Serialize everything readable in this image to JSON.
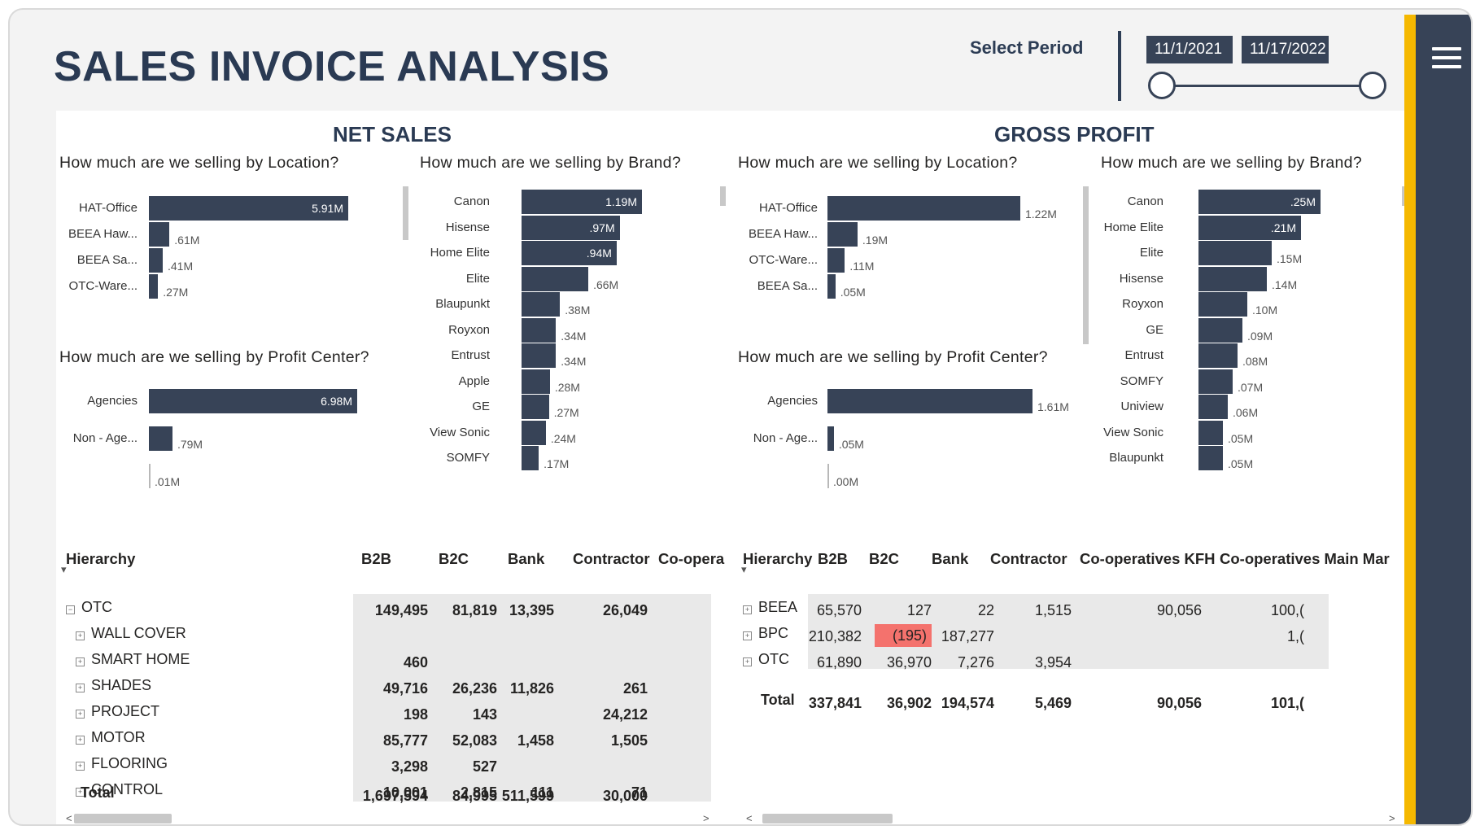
{
  "title": "SALES INVOICE ANALYSIS",
  "period": {
    "label": "Select Period",
    "start": "11/1/2021",
    "end": "11/17/2022"
  },
  "net_sales": {
    "title": "NET SALES",
    "by_location": {
      "question": "How much are we selling by Location?",
      "chart_data": {
        "type": "bar",
        "orientation": "horizontal",
        "categories": [
          "HAT-Office",
          "BEEA Haw...",
          "BEEA Sa...",
          "OTC-Ware..."
        ],
        "values": [
          5.91,
          0.61,
          0.41,
          0.27
        ],
        "labels": [
          "5.91M",
          ".61M",
          ".41M",
          ".27M"
        ]
      }
    },
    "by_brand": {
      "question": "How much are we selling by Brand?",
      "chart_data": {
        "type": "bar",
        "orientation": "horizontal",
        "categories": [
          "Canon",
          "Hisense",
          "Home Elite",
          "Elite",
          "Blaupunkt",
          "Royxon",
          "Entrust",
          "Apple",
          "GE",
          "View Sonic",
          "SOMFY"
        ],
        "values": [
          1.19,
          0.97,
          0.94,
          0.66,
          0.38,
          0.34,
          0.34,
          0.28,
          0.27,
          0.24,
          0.17
        ],
        "labels": [
          "1.19M",
          ".97M",
          ".94M",
          ".66M",
          ".38M",
          ".34M",
          ".34M",
          ".28M",
          ".27M",
          ".24M",
          ".17M"
        ]
      }
    },
    "by_profit_center": {
      "question": "How much are we selling by Profit Center?",
      "chart_data": {
        "type": "bar",
        "orientation": "horizontal",
        "categories": [
          "Agencies",
          "Non - Age...",
          ""
        ],
        "values": [
          6.98,
          0.79,
          0.01
        ],
        "labels": [
          "6.98M",
          ".79M",
          ".01M"
        ]
      }
    },
    "matrix": {
      "columns": [
        "Hierarchy",
        "B2B",
        "B2C",
        "Bank",
        "Contractor",
        "Co-opera"
      ],
      "rows": [
        {
          "label": "OTC",
          "level": 0,
          "values": [
            "149,495",
            "81,819",
            "13,395",
            "26,049"
          ]
        },
        {
          "label": "WALL COVER",
          "level": 1,
          "values": [
            "",
            "",
            "",
            ""
          ]
        },
        {
          "label": "SMART HOME",
          "level": 1,
          "values": [
            "460",
            "",
            "",
            ""
          ]
        },
        {
          "label": "SHADES",
          "level": 1,
          "values": [
            "49,716",
            "26,236",
            "11,826",
            "261"
          ]
        },
        {
          "label": "PROJECT",
          "level": 1,
          "values": [
            "198",
            "143",
            "",
            "24,212"
          ]
        },
        {
          "label": "MOTOR",
          "level": 1,
          "values": [
            "85,777",
            "52,083",
            "1,458",
            "1,505"
          ]
        },
        {
          "label": "FLOORING",
          "level": 1,
          "values": [
            "3,298",
            "527",
            "",
            ""
          ]
        },
        {
          "label": "CONTROL",
          "level": 1,
          "values": [
            "10,001",
            "2,815",
            "111",
            "71"
          ]
        }
      ],
      "total": {
        "label": "Total",
        "values": [
          "1,697,594",
          "84,995",
          "511,599",
          "30,000"
        ]
      }
    }
  },
  "gross_profit": {
    "title": "GROSS PROFIT",
    "by_location": {
      "question": "How much are we selling by Location?",
      "chart_data": {
        "type": "bar",
        "orientation": "horizontal",
        "categories": [
          "HAT-Office",
          "BEEA Haw...",
          "OTC-Ware...",
          "BEEA Sa..."
        ],
        "values": [
          1.22,
          0.19,
          0.11,
          0.05
        ],
        "labels": [
          "1.22M",
          ".19M",
          ".11M",
          ".05M"
        ]
      }
    },
    "by_brand": {
      "question": "How much are we selling by Brand?",
      "chart_data": {
        "type": "bar",
        "orientation": "horizontal",
        "categories": [
          "Canon",
          "Home Elite",
          "Elite",
          "Hisense",
          "Royxon",
          "GE",
          "Entrust",
          "SOMFY",
          "Uniview",
          "View Sonic",
          "Blaupunkt"
        ],
        "values": [
          0.25,
          0.21,
          0.15,
          0.14,
          0.1,
          0.09,
          0.08,
          0.07,
          0.06,
          0.05,
          0.05
        ],
        "labels": [
          ".25M",
          ".21M",
          ".15M",
          ".14M",
          ".10M",
          ".09M",
          ".08M",
          ".07M",
          ".06M",
          ".05M",
          ".05M"
        ]
      }
    },
    "by_profit_center": {
      "question": "How much are we selling by Profit Center?",
      "chart_data": {
        "type": "bar",
        "orientation": "horizontal",
        "categories": [
          "Agencies",
          "Non - Age...",
          ""
        ],
        "values": [
          1.61,
          0.05,
          0.0
        ],
        "labels": [
          "1.61M",
          ".05M",
          ".00M"
        ]
      }
    },
    "matrix": {
      "columns": [
        "Hierarchy",
        "B2B",
        "B2C",
        "Bank",
        "Contractor",
        "Co-operatives KFH",
        "Co-operatives Main Mar"
      ],
      "rows": [
        {
          "label": "BEEA",
          "values": [
            "65,570",
            "127",
            "22",
            "1,515",
            "90,056",
            "100,("
          ]
        },
        {
          "label": "BPC",
          "values": [
            "210,382",
            "(195)",
            "187,277",
            "",
            "",
            "1,("
          ]
        },
        {
          "label": "OTC",
          "values": [
            "61,890",
            "36,970",
            "7,276",
            "3,954",
            "",
            ""
          ]
        }
      ],
      "total": {
        "label": "Total",
        "values": [
          "337,841",
          "36,902",
          "194,574",
          "5,469",
          "90,056",
          "101,("
        ]
      },
      "highlight_color": "#f4726d"
    }
  },
  "colors": {
    "bar": "#374357",
    "title": "#2a3a53",
    "accent": "#f5b800",
    "rail": "#374357"
  },
  "icons": {
    "menu": "hamburger-icon"
  }
}
